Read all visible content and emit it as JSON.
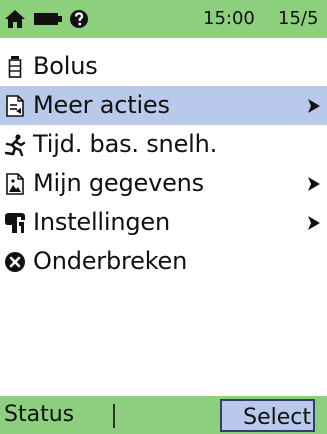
{
  "statusbar": {
    "time": "15:00",
    "date": "15/5",
    "icons": [
      "home-icon",
      "battery-icon",
      "help-icon"
    ]
  },
  "menu": {
    "items": [
      {
        "label": "Bolus",
        "icon": "bolus-icon",
        "submenu": false,
        "selected": false
      },
      {
        "label": "Meer acties",
        "icon": "document-icon",
        "submenu": true,
        "selected": true
      },
      {
        "label": "Tijd. bas. snelh.",
        "icon": "running-person-icon",
        "submenu": false,
        "selected": false
      },
      {
        "label": "Mijn gegevens",
        "icon": "image-icon",
        "submenu": true,
        "selected": false
      },
      {
        "label": "Instellingen",
        "icon": "settings-icon",
        "submenu": true,
        "selected": false
      },
      {
        "label": "Onderbreken",
        "icon": "stop-icon",
        "submenu": false,
        "selected": false
      }
    ]
  },
  "softkeys": {
    "left": "Status",
    "right": "Select"
  },
  "colors": {
    "bar": "#8ccf7c",
    "selection": "#b8c9eb",
    "selection_border": "#2f3e6a"
  }
}
